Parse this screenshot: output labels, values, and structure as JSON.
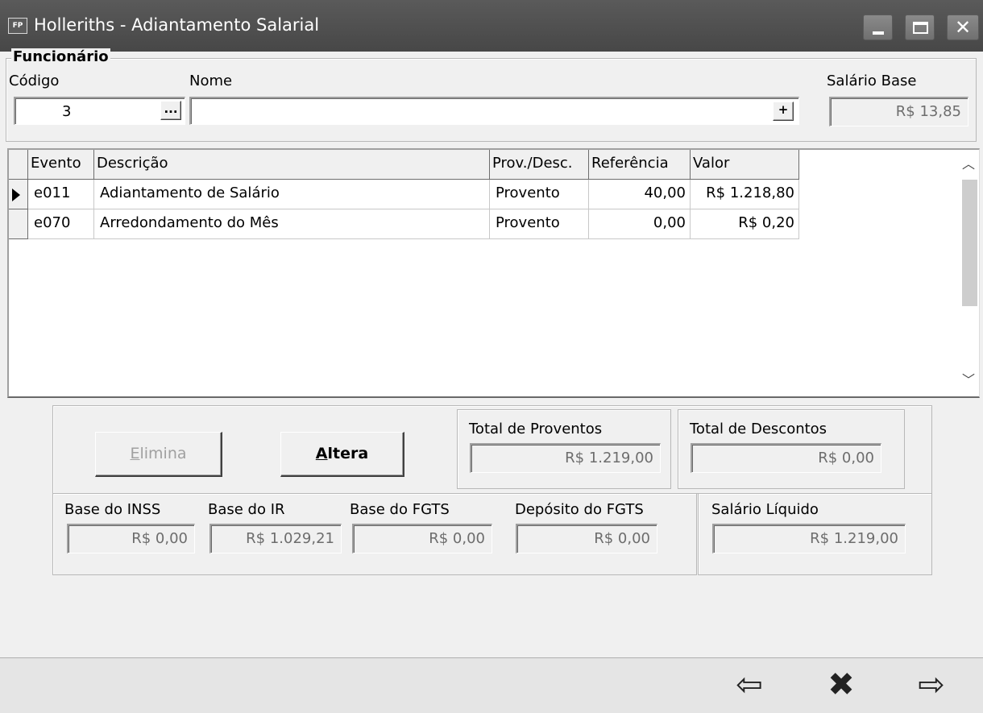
{
  "window": {
    "title": "Holleriths - Adiantamento Salarial",
    "app_icon": "FP",
    "controls": [
      "minimize-icon",
      "maximize-icon",
      "close-icon"
    ]
  },
  "funcionario": {
    "group_title": "Funcionário",
    "codigo_label": "Código",
    "codigo_value": "3",
    "lookup_button": "...",
    "nome_label": "Nome",
    "nome_value": "",
    "add_button": "+",
    "salario_base_label": "Salário Base",
    "salario_base_value": "R$ 13,85"
  },
  "grid": {
    "columns": [
      "Evento",
      "Descrição",
      "Prov./Desc.",
      "Referência",
      "Valor"
    ],
    "rows": [
      {
        "evento": "e011",
        "descricao": "Adiantamento de Salário",
        "prov_desc": "Provento",
        "referencia": "40,00",
        "valor": "R$ 1.218,80",
        "selected": true
      },
      {
        "evento": "e070",
        "descricao": "Arredondamento do Mês",
        "prov_desc": "Provento",
        "referencia": "0,00",
        "valor": "R$ 0,20",
        "selected": false
      }
    ]
  },
  "actions": {
    "elimina_label": "Elimina",
    "elimina_enabled": false,
    "altera_label": "Altera"
  },
  "totals": {
    "proventos_label": "Total de Proventos",
    "proventos_value": "R$ 1.219,00",
    "descontos_label": "Total de Descontos",
    "descontos_value": "R$ 0,00"
  },
  "bases": {
    "inss_label": "Base do INSS",
    "inss_value": "R$ 0,00",
    "ir_label": "Base do IR",
    "ir_value": "R$ 1.029,21",
    "fgts_label": "Base do FGTS",
    "fgts_value": "R$ 0,00",
    "deposito_fgts_label": "Depósito do FGTS",
    "deposito_fgts_value": "R$ 0,00",
    "salario_liquido_label": "Salário Líquido",
    "salario_liquido_value": "R$ 1.219,00"
  },
  "navigation": {
    "previous_icon": "⇦",
    "cancel_icon": "✖",
    "next_icon": "⇨"
  }
}
